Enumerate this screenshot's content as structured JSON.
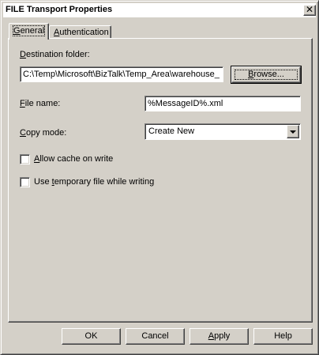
{
  "window": {
    "title": "FILE Transport Properties",
    "close_glyph": "✕"
  },
  "tabs": [
    {
      "label": "General",
      "accesskey": "G",
      "rest": "eneral",
      "selected": true
    },
    {
      "label": "Authentication",
      "accesskey": "A",
      "rest": "uthentication",
      "selected": false
    }
  ],
  "form": {
    "destination_folder": {
      "label_key": "D",
      "label_rest": "estination folder:",
      "value": "C:\\Temp\\Microsoft\\BizTalk\\Temp_Area\\warehouse_",
      "browse_key": "B",
      "browse_rest": "rowse..."
    },
    "file_name": {
      "label_key": "F",
      "label_rest": "ile name:",
      "value": "%MessageID%.xml"
    },
    "copy_mode": {
      "label_key": "C",
      "label_rest": "opy mode:",
      "selected": "Create New"
    },
    "allow_cache": {
      "label_key": "A",
      "label_rest": "llow cache on write",
      "checked": false
    },
    "temp_file": {
      "label_pre": "Use ",
      "label_key": "t",
      "label_rest": "emporary file while writing",
      "checked": false
    }
  },
  "footer": {
    "ok": "OK",
    "cancel": "Cancel",
    "apply_key": "A",
    "apply_rest": "pply",
    "help": "Help"
  },
  "colors": {
    "face": "#d4d0c8",
    "highlight": "#ffffff",
    "shadow": "#808080",
    "dark_shadow": "#404040"
  }
}
